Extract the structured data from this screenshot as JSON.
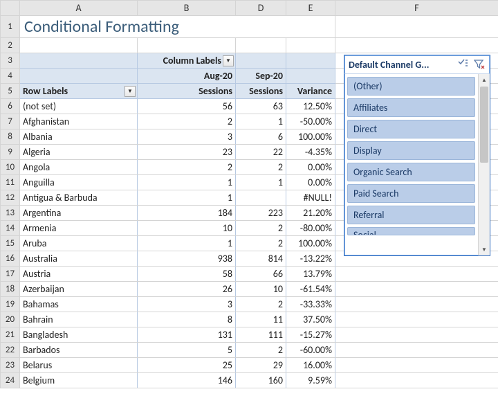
{
  "columns": [
    "A",
    "B",
    "D",
    "E",
    "F"
  ],
  "title": "Conditional Formatting",
  "pivot": {
    "column_labels_label": "Column Labels",
    "row_labels_label": "Row Labels",
    "periods": [
      "Aug-20",
      "Sep-20"
    ],
    "measures": {
      "sessions": "Sessions",
      "variance": "Variance"
    }
  },
  "rows": [
    {
      "n": 6,
      "label": "(not set)",
      "aug": "56",
      "sep": "63",
      "var": "12.50%"
    },
    {
      "n": 7,
      "label": "Afghanistan",
      "aug": "2",
      "sep": "1",
      "var": "-50.00%"
    },
    {
      "n": 8,
      "label": "Albania",
      "aug": "3",
      "sep": "6",
      "var": "100.00%"
    },
    {
      "n": 9,
      "label": "Algeria",
      "aug": "23",
      "sep": "22",
      "var": "-4.35%"
    },
    {
      "n": 10,
      "label": "Angola",
      "aug": "2",
      "sep": "2",
      "var": "0.00%"
    },
    {
      "n": 11,
      "label": "Anguilla",
      "aug": "1",
      "sep": "1",
      "var": "0.00%"
    },
    {
      "n": 12,
      "label": "Antigua & Barbuda",
      "aug": "1",
      "sep": "",
      "var": "#NULL!"
    },
    {
      "n": 13,
      "label": "Argentina",
      "aug": "184",
      "sep": "223",
      "var": "21.20%"
    },
    {
      "n": 14,
      "label": "Armenia",
      "aug": "10",
      "sep": "2",
      "var": "-80.00%"
    },
    {
      "n": 15,
      "label": "Aruba",
      "aug": "1",
      "sep": "2",
      "var": "100.00%"
    },
    {
      "n": 16,
      "label": "Australia",
      "aug": "938",
      "sep": "814",
      "var": "-13.22%"
    },
    {
      "n": 17,
      "label": "Austria",
      "aug": "58",
      "sep": "66",
      "var": "13.79%"
    },
    {
      "n": 18,
      "label": "Azerbaijan",
      "aug": "26",
      "sep": "10",
      "var": "-61.54%"
    },
    {
      "n": 19,
      "label": "Bahamas",
      "aug": "3",
      "sep": "2",
      "var": "-33.33%"
    },
    {
      "n": 20,
      "label": "Bahrain",
      "aug": "8",
      "sep": "11",
      "var": "37.50%"
    },
    {
      "n": 21,
      "label": "Bangladesh",
      "aug": "131",
      "sep": "111",
      "var": "-15.27%"
    },
    {
      "n": 22,
      "label": "Barbados",
      "aug": "5",
      "sep": "2",
      "var": "-60.00%"
    },
    {
      "n": 23,
      "label": "Belarus",
      "aug": "25",
      "sep": "29",
      "var": "16.00%"
    },
    {
      "n": 24,
      "label": "Belgium",
      "aug": "146",
      "sep": "160",
      "var": "9.59%"
    }
  ],
  "slicer": {
    "title": "Default Channel G...",
    "items": [
      "(Other)",
      "Affiliates",
      "Direct",
      "Display",
      "Organic Search",
      "Paid Search",
      "Referral"
    ],
    "partial_item": "Social"
  }
}
